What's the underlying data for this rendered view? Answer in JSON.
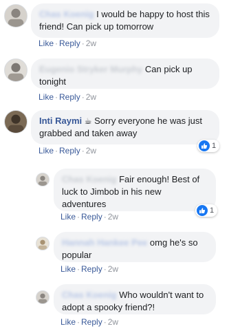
{
  "comments": [
    {
      "author": "Chas Koenig",
      "author_hidden": true,
      "text": "I would be happy to host this friend! Can pick up tomorrow",
      "actions": {
        "like": "Like",
        "reply": "Reply",
        "time": "2w"
      }
    },
    {
      "author": "Eugenio Stryker Murphy",
      "author_hidden": true,
      "text": "Can pick up tonight",
      "actions": {
        "like": "Like",
        "reply": "Reply",
        "time": "2w"
      }
    },
    {
      "author": "Inti Raymi",
      "author_emoji": "☕",
      "text": "Sorry everyone he was just grabbed and taken away",
      "actions": {
        "like": "Like",
        "reply": "Reply",
        "time": "2w"
      },
      "reaction_count": "1"
    }
  ],
  "replies": [
    {
      "author": "Chas Koenig",
      "author_hidden": true,
      "text": "Fair enough! Best of luck to Jimbob in his new adventures",
      "actions": {
        "like": "Like",
        "reply": "Reply",
        "time": "2w"
      },
      "reaction_count": "1"
    },
    {
      "author": "Hannah Hankee Pee",
      "author_hidden": true,
      "text": "omg he's so popular",
      "actions": {
        "like": "Like",
        "reply": "Reply",
        "time": "2w"
      }
    },
    {
      "author": "Chas Koenig",
      "author_hidden": true,
      "text": "Who wouldn't want to adopt a spooky friend?!",
      "actions": {
        "like": "Like",
        "reply": "Reply",
        "time": "2w"
      }
    }
  ],
  "colors": {
    "link": "#385898",
    "bubble": "#f2f3f5",
    "meta": "#90949c",
    "like_blue": "#1877f2"
  },
  "icons": {
    "reaction": "thumbs-up-icon"
  }
}
